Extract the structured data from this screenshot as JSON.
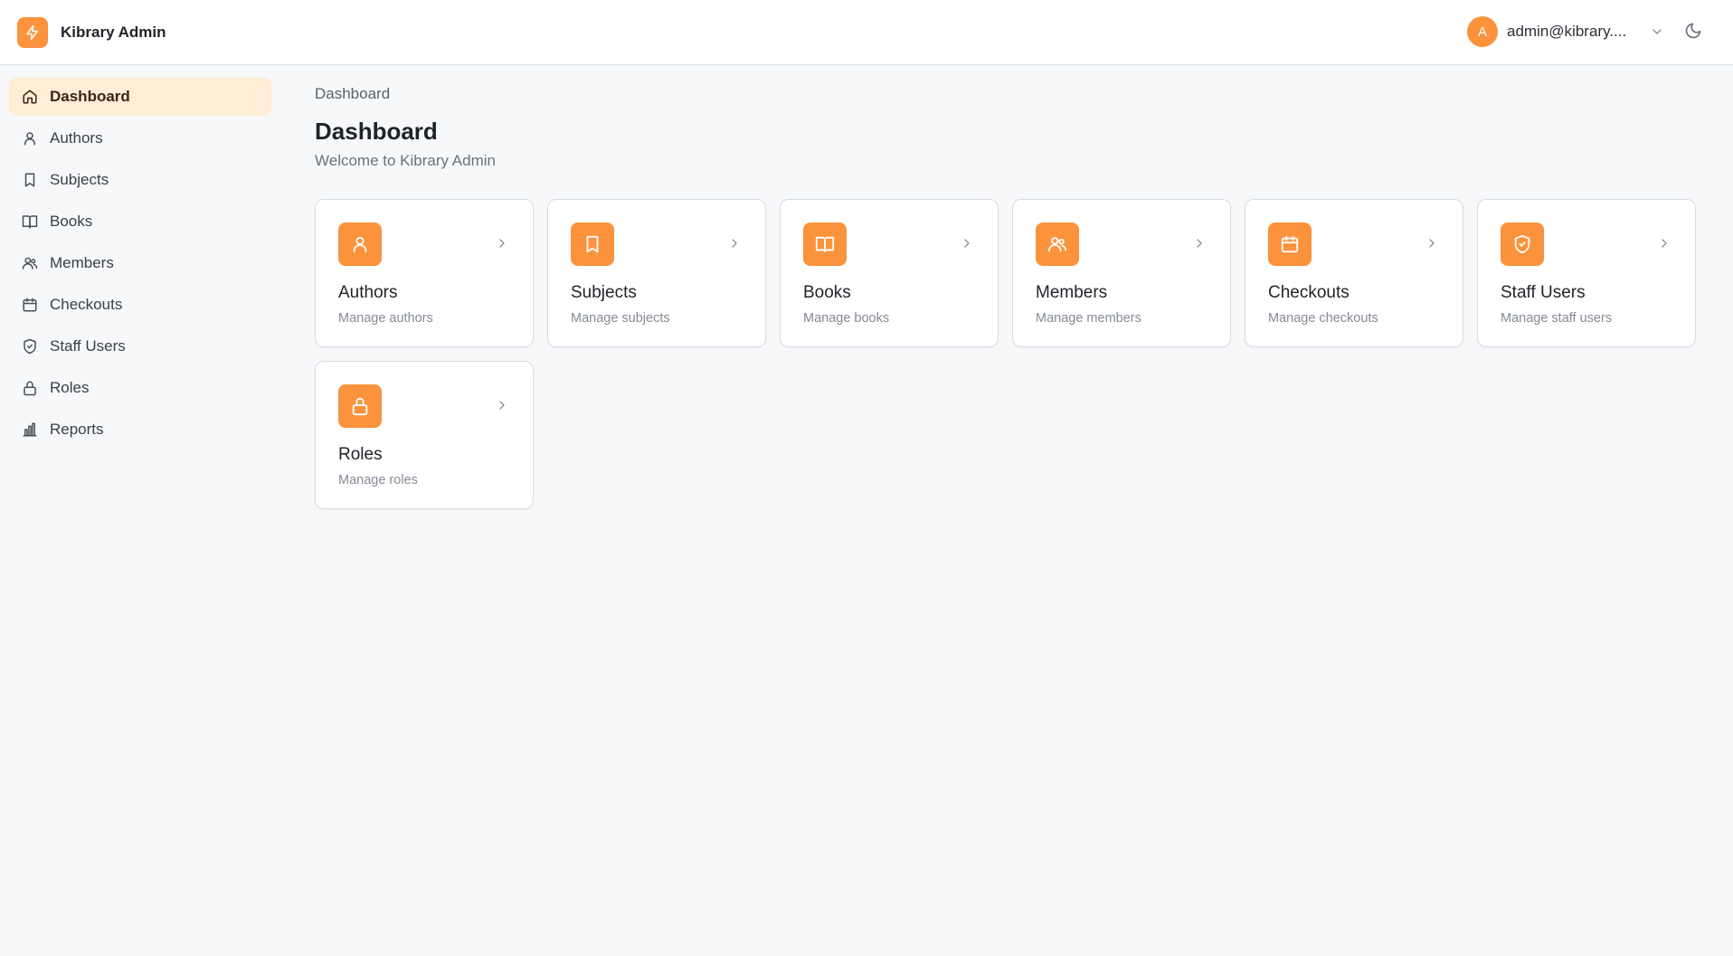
{
  "header": {
    "app_name": "Kibrary Admin",
    "user_initial": "A",
    "user_email": "admin@kibrary....",
    "brand_color": "#fb923c"
  },
  "sidebar": {
    "items": [
      {
        "label": "Dashboard",
        "icon": "home-icon",
        "active": true
      },
      {
        "label": "Authors",
        "icon": "user-icon"
      },
      {
        "label": "Subjects",
        "icon": "bookmark-icon"
      },
      {
        "label": "Books",
        "icon": "book-open-icon"
      },
      {
        "label": "Members",
        "icon": "users-icon"
      },
      {
        "label": "Checkouts",
        "icon": "calendar-icon"
      },
      {
        "label": "Staff Users",
        "icon": "shield-check-icon"
      },
      {
        "label": "Roles",
        "icon": "lock-icon"
      },
      {
        "label": "Reports",
        "icon": "bar-chart-icon"
      }
    ]
  },
  "main": {
    "breadcrumb": "Dashboard",
    "title": "Dashboard",
    "subtitle": "Welcome to Kibrary Admin",
    "cards": [
      {
        "title": "Authors",
        "description": "Manage authors",
        "icon": "user-icon"
      },
      {
        "title": "Subjects",
        "description": "Manage subjects",
        "icon": "bookmark-icon"
      },
      {
        "title": "Books",
        "description": "Manage books",
        "icon": "book-open-icon"
      },
      {
        "title": "Members",
        "description": "Manage members",
        "icon": "users-icon"
      },
      {
        "title": "Checkouts",
        "description": "Manage checkouts",
        "icon": "calendar-icon"
      },
      {
        "title": "Staff Users",
        "description": "Manage staff users",
        "icon": "shield-check-icon"
      },
      {
        "title": "Roles",
        "description": "Manage roles",
        "icon": "lock-icon"
      }
    ]
  }
}
